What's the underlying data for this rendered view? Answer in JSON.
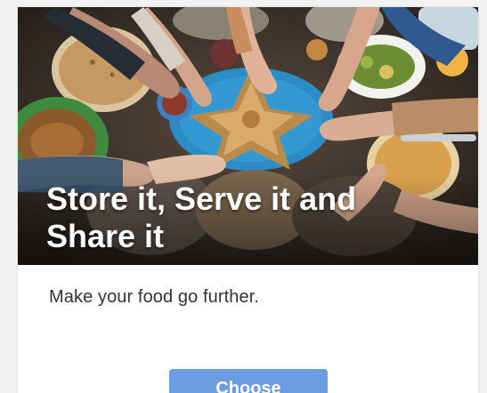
{
  "card": {
    "title": "Store it, Serve it and Share it",
    "subtitle": "Make your food go further.",
    "button_label": "Choose",
    "image_alt": "Hands reaching for shared food on a table"
  },
  "colors": {
    "button": "#6b9de0",
    "card_bg": "#ffffff",
    "title_text": "#ffffff",
    "body_text": "#333333"
  }
}
